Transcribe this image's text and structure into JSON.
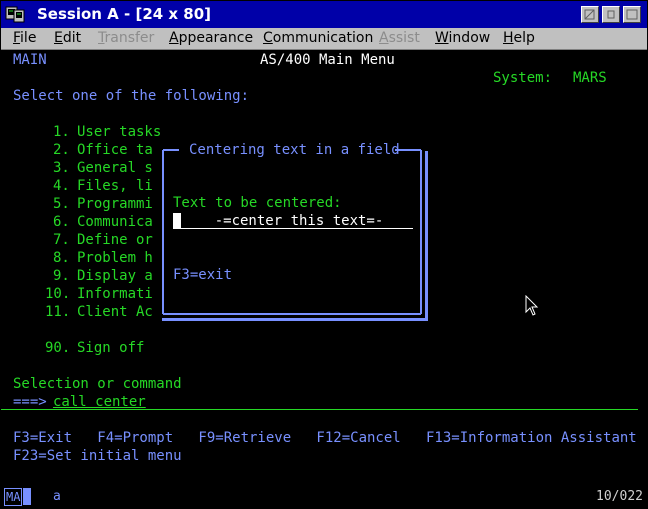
{
  "window": {
    "title": "Session A - [24 x 80]"
  },
  "menu": {
    "items": [
      {
        "label": "File",
        "underline": "F",
        "rest": "ile",
        "enabled": true
      },
      {
        "label": "Edit",
        "underline": "E",
        "rest": "dit",
        "enabled": true
      },
      {
        "label": "Transfer",
        "underline": "T",
        "rest": "ransfer",
        "enabled": false
      },
      {
        "label": "Appearance",
        "underline": "A",
        "rest": "ppearance",
        "enabled": true
      },
      {
        "label": "Communication",
        "underline": "C",
        "rest": "ommunication",
        "enabled": true
      },
      {
        "label": "Assist",
        "underline": "A",
        "rest": "ssist",
        "enabled": false
      },
      {
        "label": "Window",
        "underline": "W",
        "rest": "indow",
        "enabled": true
      },
      {
        "label": "Help",
        "underline": "H",
        "rest": "elp",
        "enabled": true
      }
    ]
  },
  "screen": {
    "menu_id": "MAIN",
    "title": "AS/400 Main Menu",
    "system_label": "System:",
    "system_name": "MARS",
    "prompt": "Select one of the following:",
    "options": [
      {
        "num": "1.",
        "text": "User tasks"
      },
      {
        "num": "2.",
        "text": "Office ta"
      },
      {
        "num": "3.",
        "text": "General s"
      },
      {
        "num": "4.",
        "text": "Files, li"
      },
      {
        "num": "5.",
        "text": "Programmi"
      },
      {
        "num": "6.",
        "text": "Communica"
      },
      {
        "num": "7.",
        "text": "Define or"
      },
      {
        "num": "8.",
        "text": "Problem h"
      },
      {
        "num": "9.",
        "text": "Display a"
      },
      {
        "num": "10.",
        "text": "Informati"
      },
      {
        "num": "11.",
        "text": "Client Ac"
      },
      {
        "num": "90.",
        "text": "Sign off"
      }
    ],
    "selection_label": "Selection or command",
    "command_arrow": "===>",
    "command_value": "call center",
    "fkeys_line1": "F3=Exit   F4=Prompt   F9=Retrieve   F12=Cancel   F13=Information Assistant",
    "fkeys_line2": "F23=Set initial menu"
  },
  "popup": {
    "title": "Centering text in a field",
    "field_label": "Text to be centered:",
    "field_value": "    -=center this text=-",
    "fkey": "F3=exit"
  },
  "status": {
    "session": "MA",
    "indicator": "a",
    "cursor_pos": "10/022"
  },
  "colors": {
    "terminal_bg": "#000000",
    "blue_text": "#7890ff",
    "green_text": "#26d826",
    "titlebar": "#0000a8"
  }
}
